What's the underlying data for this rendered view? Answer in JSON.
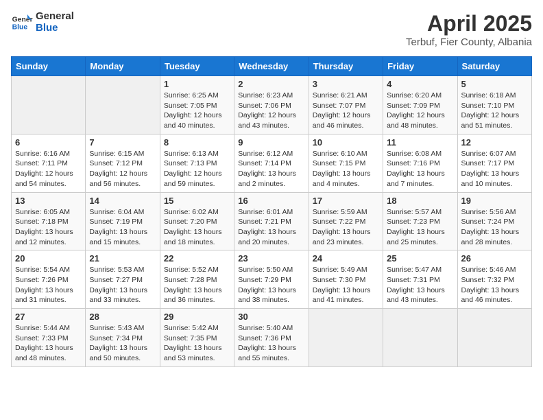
{
  "header": {
    "logo_line1": "General",
    "logo_line2": "Blue",
    "month": "April 2025",
    "location": "Terbuf, Fier County, Albania"
  },
  "weekdays": [
    "Sunday",
    "Monday",
    "Tuesday",
    "Wednesday",
    "Thursday",
    "Friday",
    "Saturday"
  ],
  "weeks": [
    [
      {
        "day": "",
        "sunrise": "",
        "sunset": "",
        "daylight": ""
      },
      {
        "day": "",
        "sunrise": "",
        "sunset": "",
        "daylight": ""
      },
      {
        "day": "1",
        "sunrise": "Sunrise: 6:25 AM",
        "sunset": "Sunset: 7:05 PM",
        "daylight": "Daylight: 12 hours and 40 minutes."
      },
      {
        "day": "2",
        "sunrise": "Sunrise: 6:23 AM",
        "sunset": "Sunset: 7:06 PM",
        "daylight": "Daylight: 12 hours and 43 minutes."
      },
      {
        "day": "3",
        "sunrise": "Sunrise: 6:21 AM",
        "sunset": "Sunset: 7:07 PM",
        "daylight": "Daylight: 12 hours and 46 minutes."
      },
      {
        "day": "4",
        "sunrise": "Sunrise: 6:20 AM",
        "sunset": "Sunset: 7:09 PM",
        "daylight": "Daylight: 12 hours and 48 minutes."
      },
      {
        "day": "5",
        "sunrise": "Sunrise: 6:18 AM",
        "sunset": "Sunset: 7:10 PM",
        "daylight": "Daylight: 12 hours and 51 minutes."
      }
    ],
    [
      {
        "day": "6",
        "sunrise": "Sunrise: 6:16 AM",
        "sunset": "Sunset: 7:11 PM",
        "daylight": "Daylight: 12 hours and 54 minutes."
      },
      {
        "day": "7",
        "sunrise": "Sunrise: 6:15 AM",
        "sunset": "Sunset: 7:12 PM",
        "daylight": "Daylight: 12 hours and 56 minutes."
      },
      {
        "day": "8",
        "sunrise": "Sunrise: 6:13 AM",
        "sunset": "Sunset: 7:13 PM",
        "daylight": "Daylight: 12 hours and 59 minutes."
      },
      {
        "day": "9",
        "sunrise": "Sunrise: 6:12 AM",
        "sunset": "Sunset: 7:14 PM",
        "daylight": "Daylight: 13 hours and 2 minutes."
      },
      {
        "day": "10",
        "sunrise": "Sunrise: 6:10 AM",
        "sunset": "Sunset: 7:15 PM",
        "daylight": "Daylight: 13 hours and 4 minutes."
      },
      {
        "day": "11",
        "sunrise": "Sunrise: 6:08 AM",
        "sunset": "Sunset: 7:16 PM",
        "daylight": "Daylight: 13 hours and 7 minutes."
      },
      {
        "day": "12",
        "sunrise": "Sunrise: 6:07 AM",
        "sunset": "Sunset: 7:17 PM",
        "daylight": "Daylight: 13 hours and 10 minutes."
      }
    ],
    [
      {
        "day": "13",
        "sunrise": "Sunrise: 6:05 AM",
        "sunset": "Sunset: 7:18 PM",
        "daylight": "Daylight: 13 hours and 12 minutes."
      },
      {
        "day": "14",
        "sunrise": "Sunrise: 6:04 AM",
        "sunset": "Sunset: 7:19 PM",
        "daylight": "Daylight: 13 hours and 15 minutes."
      },
      {
        "day": "15",
        "sunrise": "Sunrise: 6:02 AM",
        "sunset": "Sunset: 7:20 PM",
        "daylight": "Daylight: 13 hours and 18 minutes."
      },
      {
        "day": "16",
        "sunrise": "Sunrise: 6:01 AM",
        "sunset": "Sunset: 7:21 PM",
        "daylight": "Daylight: 13 hours and 20 minutes."
      },
      {
        "day": "17",
        "sunrise": "Sunrise: 5:59 AM",
        "sunset": "Sunset: 7:22 PM",
        "daylight": "Daylight: 13 hours and 23 minutes."
      },
      {
        "day": "18",
        "sunrise": "Sunrise: 5:57 AM",
        "sunset": "Sunset: 7:23 PM",
        "daylight": "Daylight: 13 hours and 25 minutes."
      },
      {
        "day": "19",
        "sunrise": "Sunrise: 5:56 AM",
        "sunset": "Sunset: 7:24 PM",
        "daylight": "Daylight: 13 hours and 28 minutes."
      }
    ],
    [
      {
        "day": "20",
        "sunrise": "Sunrise: 5:54 AM",
        "sunset": "Sunset: 7:26 PM",
        "daylight": "Daylight: 13 hours and 31 minutes."
      },
      {
        "day": "21",
        "sunrise": "Sunrise: 5:53 AM",
        "sunset": "Sunset: 7:27 PM",
        "daylight": "Daylight: 13 hours and 33 minutes."
      },
      {
        "day": "22",
        "sunrise": "Sunrise: 5:52 AM",
        "sunset": "Sunset: 7:28 PM",
        "daylight": "Daylight: 13 hours and 36 minutes."
      },
      {
        "day": "23",
        "sunrise": "Sunrise: 5:50 AM",
        "sunset": "Sunset: 7:29 PM",
        "daylight": "Daylight: 13 hours and 38 minutes."
      },
      {
        "day": "24",
        "sunrise": "Sunrise: 5:49 AM",
        "sunset": "Sunset: 7:30 PM",
        "daylight": "Daylight: 13 hours and 41 minutes."
      },
      {
        "day": "25",
        "sunrise": "Sunrise: 5:47 AM",
        "sunset": "Sunset: 7:31 PM",
        "daylight": "Daylight: 13 hours and 43 minutes."
      },
      {
        "day": "26",
        "sunrise": "Sunrise: 5:46 AM",
        "sunset": "Sunset: 7:32 PM",
        "daylight": "Daylight: 13 hours and 46 minutes."
      }
    ],
    [
      {
        "day": "27",
        "sunrise": "Sunrise: 5:44 AM",
        "sunset": "Sunset: 7:33 PM",
        "daylight": "Daylight: 13 hours and 48 minutes."
      },
      {
        "day": "28",
        "sunrise": "Sunrise: 5:43 AM",
        "sunset": "Sunset: 7:34 PM",
        "daylight": "Daylight: 13 hours and 50 minutes."
      },
      {
        "day": "29",
        "sunrise": "Sunrise: 5:42 AM",
        "sunset": "Sunset: 7:35 PM",
        "daylight": "Daylight: 13 hours and 53 minutes."
      },
      {
        "day": "30",
        "sunrise": "Sunrise: 5:40 AM",
        "sunset": "Sunset: 7:36 PM",
        "daylight": "Daylight: 13 hours and 55 minutes."
      },
      {
        "day": "",
        "sunrise": "",
        "sunset": "",
        "daylight": ""
      },
      {
        "day": "",
        "sunrise": "",
        "sunset": "",
        "daylight": ""
      },
      {
        "day": "",
        "sunrise": "",
        "sunset": "",
        "daylight": ""
      }
    ]
  ]
}
